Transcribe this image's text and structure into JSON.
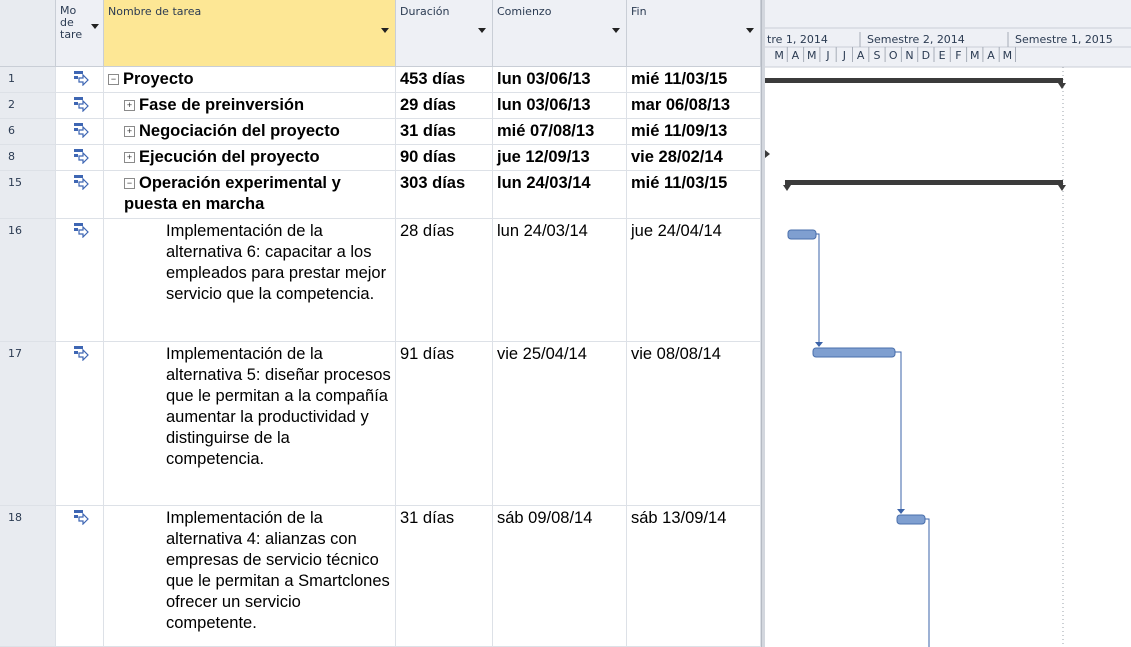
{
  "header": {
    "mode_label": "Mo de tare",
    "name_label": "Nombre de tarea",
    "duration_label": "Duración",
    "start_label": "Comienzo",
    "finish_label": "Fin"
  },
  "timescale": {
    "top": [
      "tre 1, 2014",
      "Semestre 2, 2014",
      "Semestre 1, 2015"
    ],
    "months": [
      "M",
      "A",
      "M",
      "J",
      "J",
      "A",
      "S",
      "O",
      "N",
      "D",
      "E",
      "F",
      "M",
      "A",
      "M"
    ]
  },
  "rows": [
    {
      "id": "1",
      "name": "Proyecto",
      "duration": "453 días",
      "start": "lun 03/06/13",
      "finish": "mié 11/03/15"
    },
    {
      "id": "2",
      "name": "Fase de preinversión",
      "duration": "29 días",
      "start": "lun 03/06/13",
      "finish": "mar 06/08/13"
    },
    {
      "id": "6",
      "name": "Negociación del proyecto",
      "duration": "31 días",
      "start": "mié 07/08/13",
      "finish": "mié 11/09/13"
    },
    {
      "id": "8",
      "name": "Ejecución del proyecto",
      "duration": "90 días",
      "start": "jue 12/09/13",
      "finish": "vie 28/02/14"
    },
    {
      "id": "15",
      "name": "Operación experimental y puesta en marcha",
      "duration": "303 días",
      "start": "lun 24/03/14",
      "finish": "mié 11/03/15"
    },
    {
      "id": "16",
      "name": "Implementación de la alternativa 6: capacitar a los empleados para prestar mejor servicio que la competencia.",
      "duration": "28 días",
      "start": "lun 24/03/14",
      "finish": "jue 24/04/14"
    },
    {
      "id": "17",
      "name": "Implementación de la alternativa 5: diseñar procesos que le permitan a la compañía aumentar la productividad y distinguirse de la competencia.",
      "duration": "91 días",
      "start": "vie 25/04/14",
      "finish": "vie 08/08/14"
    },
    {
      "id": "18",
      "name": "Implementación de la alternativa 4: alianzas con empresas de servicio técnico que le permitan a Smartclones ofrecer un servicio competente.",
      "duration": "31 días",
      "start": "sáb 09/08/14",
      "finish": "sáb 13/09/14"
    }
  ],
  "icons": {
    "task_mode": "auto-scheduled-task-icon",
    "collapse": "minus-box-icon",
    "expand": "plus-box-icon"
  },
  "colors": {
    "selected_header": "#fde795",
    "bar": "#7f9fd0",
    "summary_bar": "#3b3b3b",
    "link": "#3b63a8"
  }
}
